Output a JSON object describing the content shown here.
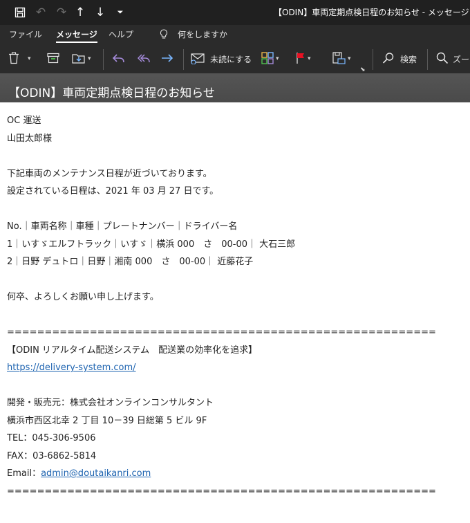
{
  "window": {
    "title": "【ODIN】車両定期点検日程のお知らせ  -  メッセージ (HT"
  },
  "ribbon": {
    "tabs": [
      {
        "label": "ファイル"
      },
      {
        "label": "メッセージ"
      },
      {
        "label": "ヘルプ"
      }
    ],
    "search": {
      "placeholder": "何をしますか"
    }
  },
  "toolbar": {
    "unread_label": "未読にする",
    "search_label": "検索",
    "zoom_label": "ズー"
  },
  "message": {
    "subject": "【ODIN】車両定期点検日程のお知らせ",
    "lines": [
      "OC 運送",
      "山田太郎様",
      "",
      "下記車両のメンテナンス日程が近づいております。",
      "設定されている日程は、2021 年 03 月 27 日です。",
      "",
      "No.｜車両名称｜車種｜プレートナンバー｜ドライバー名",
      "1｜いすゞエルフトラック｜いすゞ｜横浜 000　さ　00-00｜ 大石三郎",
      "2｜日野 デュトロ｜日野｜湘南 000　さ　00-00｜ 近藤花子",
      "",
      "何卒、よろしくお願い申し上げます。",
      "",
      "=========================================================",
      "【ODIN リアルタイム配送システム　配送業の効率化を追求】",
      "",
      "",
      "開発・販売元：株式会社オンラインコンサルタント",
      "横浜市西区北幸 2 丁目 10－39 日総第 5 ビル 9F",
      "TEL：045-306-9506",
      "FAX：03-6862-5814",
      "",
      "========================================================="
    ],
    "website_url": "https://delivery-system.com/",
    "email_label": "Email：",
    "email": "admin@doutaikanri.com"
  },
  "colors": {
    "titlebar": "#202020",
    "ribbon": "#2b2b2b",
    "subject_band": "#4f4f4f",
    "link": "#1d63b0",
    "flag": "#e81123"
  }
}
